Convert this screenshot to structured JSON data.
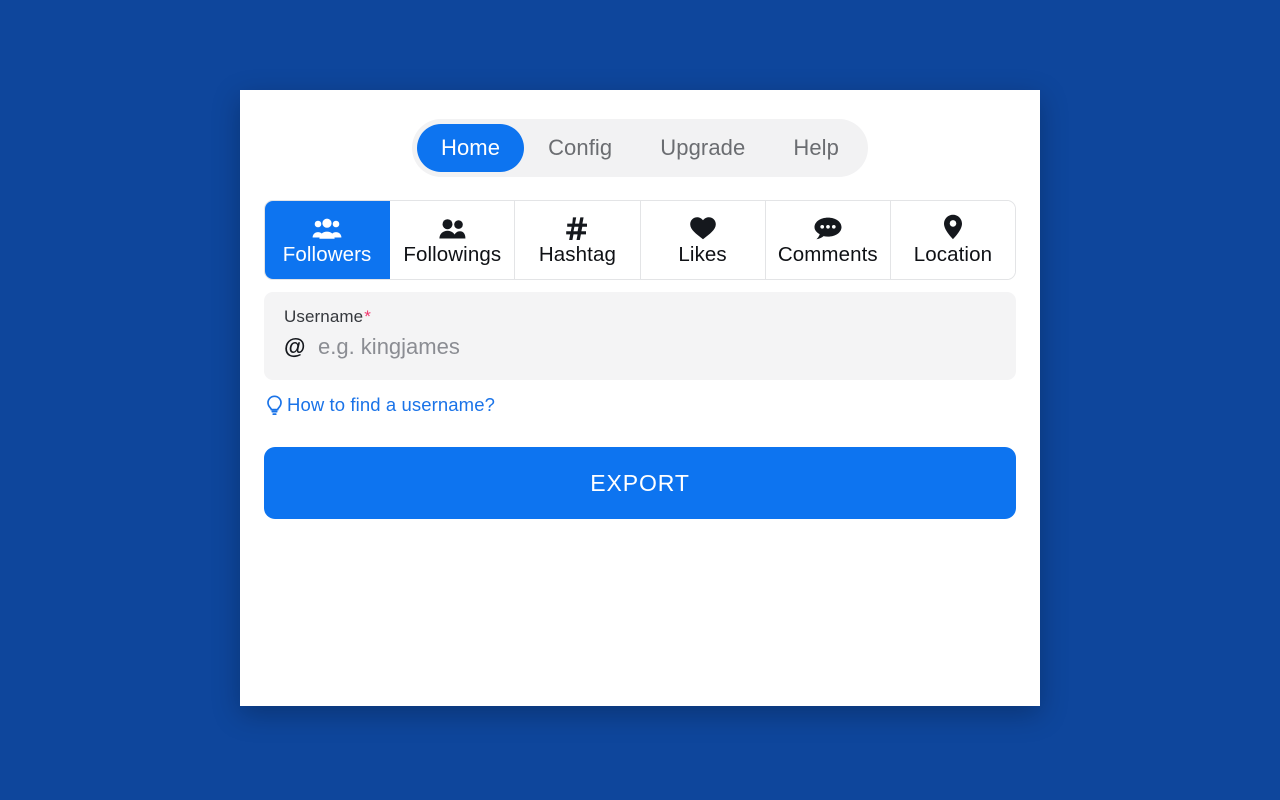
{
  "theme": {
    "page_background": "#0E469C",
    "accent_blue": "#0D74F0",
    "link_blue": "#1A73E8",
    "required_red": "#F1356D",
    "field_background": "#F4F4F5",
    "nav_background": "#F2F2F3",
    "card_background": "#FFFFFF"
  },
  "nav": {
    "items": [
      {
        "label": "Home",
        "active": true,
        "icon": "home-nav"
      },
      {
        "label": "Config",
        "active": false,
        "icon": "config-nav"
      },
      {
        "label": "Upgrade",
        "active": false,
        "icon": "upgrade-nav"
      },
      {
        "label": "Help",
        "active": false,
        "icon": "help-nav"
      }
    ]
  },
  "tabs": {
    "items": [
      {
        "label": "Followers",
        "icon": "group-three-people-icon",
        "active": true
      },
      {
        "label": "Followings",
        "icon": "two-people-icon",
        "active": false
      },
      {
        "label": "Hashtag",
        "icon": "hash-icon",
        "active": false
      },
      {
        "label": "Likes",
        "icon": "heart-icon",
        "active": false
      },
      {
        "label": "Comments",
        "icon": "comment-bubble-icon",
        "active": false
      },
      {
        "label": "Location",
        "icon": "map-pin-icon",
        "active": false
      }
    ]
  },
  "form": {
    "username": {
      "label": "Username",
      "required_marker": "*",
      "prefix_icon": "at-symbol-icon",
      "prefix_symbol": "@",
      "value": "",
      "placeholder": "e.g. kingjames"
    },
    "hint": {
      "icon": "lightbulb-icon",
      "text": "How to find a username?"
    },
    "submit": {
      "label": "EXPORT"
    }
  }
}
